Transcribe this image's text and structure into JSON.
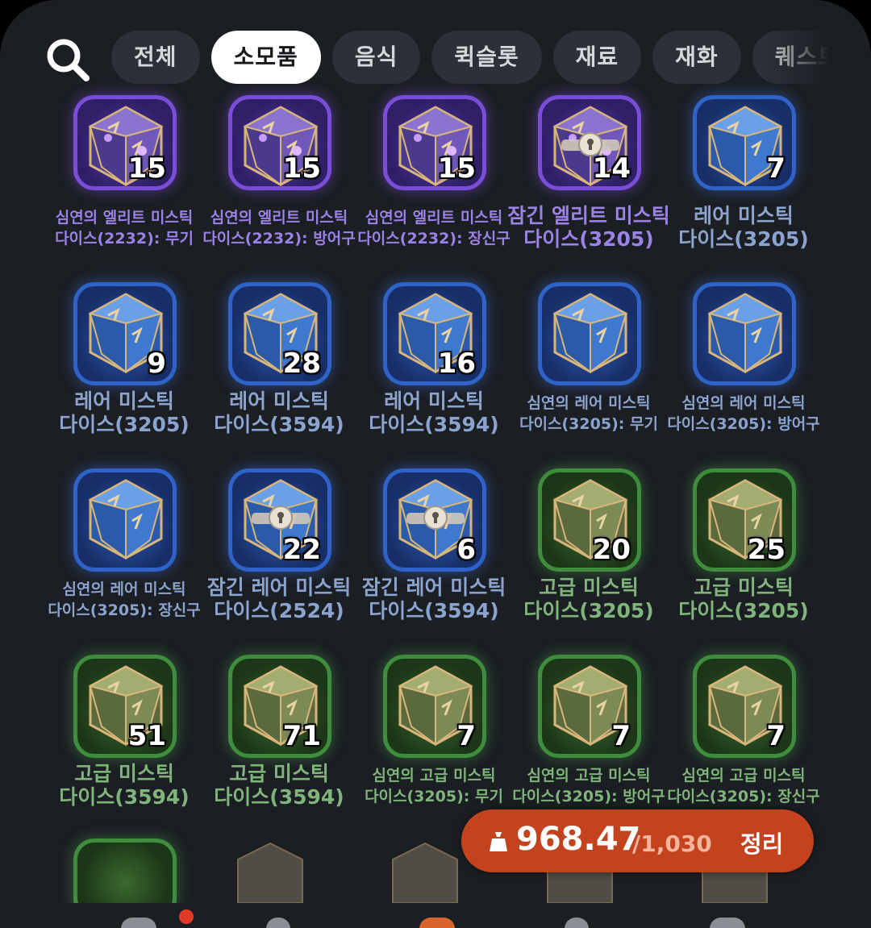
{
  "filters": {
    "tabs": [
      {
        "label": "전체",
        "active": false
      },
      {
        "label": "소모품",
        "active": true
      },
      {
        "label": "음식",
        "active": false
      },
      {
        "label": "퀵슬롯",
        "active": false
      },
      {
        "label": "재료",
        "active": false
      },
      {
        "label": "재화",
        "active": false
      },
      {
        "label": "퀘스트",
        "active": false
      }
    ]
  },
  "items": [
    {
      "count": "15",
      "rarity": "purple",
      "size": "sm",
      "line1": "심연의 엘리트 미스틱",
      "line2": "다이스(2232): 무기"
    },
    {
      "count": "15",
      "rarity": "purple",
      "size": "sm",
      "line1": "심연의 엘리트 미스틱",
      "line2": "다이스(2232): 방어구"
    },
    {
      "count": "15",
      "rarity": "purple",
      "size": "sm",
      "line1": "심연의 엘리트 미스틱",
      "line2": "다이스(2232): 장신구"
    },
    {
      "count": "14",
      "rarity": "purple",
      "size": "lg",
      "line1": "잠긴 엘리트 미스틱",
      "line2": "다이스(3205)",
      "locked": true
    },
    {
      "count": "7",
      "rarity": "blue",
      "size": "lg",
      "line1": "레어 미스틱",
      "line2": "다이스(3205)"
    },
    {
      "count": "9",
      "rarity": "blue",
      "size": "lg",
      "line1": "레어 미스틱",
      "line2": "다이스(3205)"
    },
    {
      "count": "28",
      "rarity": "blue",
      "size": "lg",
      "line1": "레어 미스틱",
      "line2": "다이스(3594)"
    },
    {
      "count": "16",
      "rarity": "blue",
      "size": "lg",
      "line1": "레어 미스틱",
      "line2": "다이스(3594)"
    },
    {
      "count": "",
      "rarity": "blue",
      "size": "sm",
      "line1": "심연의 레어 미스틱",
      "line2": "다이스(3205): 무기"
    },
    {
      "count": "",
      "rarity": "blue",
      "size": "sm",
      "line1": "심연의 레어 미스틱",
      "line2": "다이스(3205): 방어구"
    },
    {
      "count": "",
      "rarity": "blue",
      "size": "sm",
      "line1": "심연의 레어 미스틱",
      "line2": "다이스(3205): 장신구"
    },
    {
      "count": "22",
      "rarity": "blue",
      "size": "lg",
      "line1": "잠긴 레어 미스틱",
      "line2": "다이스(2524)",
      "locked": true
    },
    {
      "count": "6",
      "rarity": "blue",
      "size": "lg",
      "line1": "잠긴 레어 미스틱",
      "line2": "다이스(3594)",
      "locked": true
    },
    {
      "count": "20",
      "rarity": "green",
      "size": "lg",
      "line1": "고급 미스틱",
      "line2": "다이스(3205)"
    },
    {
      "count": "25",
      "rarity": "green",
      "size": "lg",
      "line1": "고급 미스틱",
      "line2": "다이스(3205)"
    },
    {
      "count": "51",
      "rarity": "green",
      "size": "lg",
      "line1": "고급 미스틱",
      "line2": "다이스(3594)"
    },
    {
      "count": "71",
      "rarity": "green",
      "size": "lg",
      "line1": "고급 미스틱",
      "line2": "다이스(3594)"
    },
    {
      "count": "7",
      "rarity": "green",
      "size": "sm",
      "line1": "심연의 고급 미스틱",
      "line2": "다이스(3205): 무기"
    },
    {
      "count": "7",
      "rarity": "green",
      "size": "sm",
      "line1": "심연의 고급 미스틱",
      "line2": "다이스(3205): 방어구"
    },
    {
      "count": "7",
      "rarity": "green",
      "size": "sm",
      "line1": "심연의 고급 미스틱",
      "line2": "다이스(3205): 장신구"
    }
  ],
  "weight": {
    "current": "968.47",
    "max": "/1,030",
    "sort_label": "정리",
    "icon": "weight-bag-icon"
  },
  "colors": {
    "background": "#1b1e23",
    "purple": "#7a4dd8",
    "blue": "#2f63c9",
    "green": "#3f8c3d",
    "weight_bar": "#c4431f"
  }
}
